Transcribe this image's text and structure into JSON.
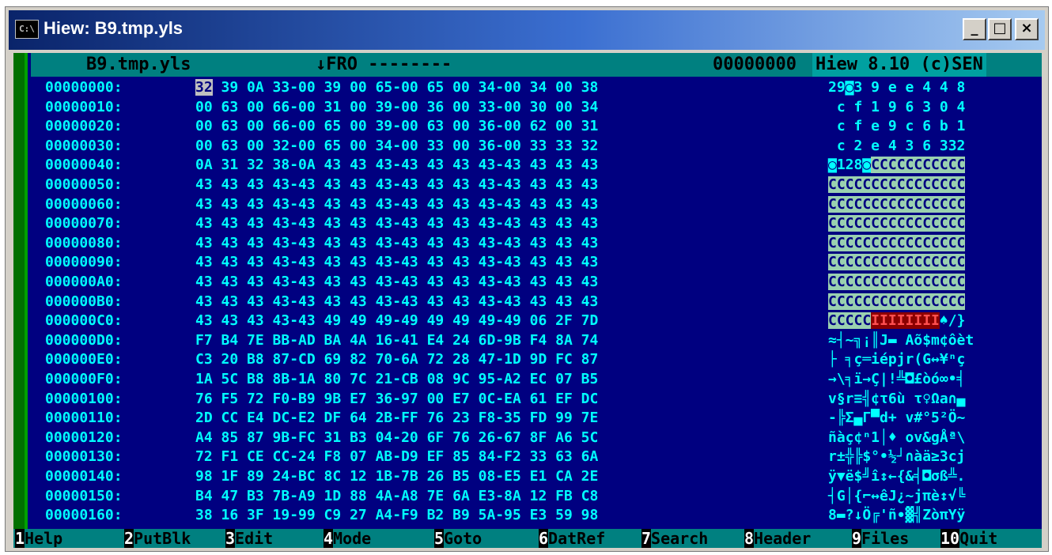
{
  "window": {
    "title": "Hiew: B9.tmp.yls",
    "icon": "C:\\"
  },
  "title_buttons": {
    "minimize": "_",
    "maximize": "□",
    "close": "×"
  },
  "status": {
    "filename": "B9.tmp.yls",
    "mode": "↓FRO --------",
    "offset": "00000000",
    "version": "Hiew 8.10 (c)SEN"
  },
  "rows": [
    {
      "addr": "00000000:",
      "hex": "32 39 0A 33-00 39 00 65-00 65 00 34-00 34 00 38",
      "ascii": "29◙3 9 e e 4 4 8"
    },
    {
      "addr": "00000010:",
      "hex": "00 63 00 66-00 31 00 39-00 36 00 33-00 30 00 34",
      "ascii": " c f 1 9 6 3 0 4"
    },
    {
      "addr": "00000020:",
      "hex": "00 63 00 66-00 65 00 39-00 63 00 36-00 62 00 31",
      "ascii": " c f e 9 c 6 b 1"
    },
    {
      "addr": "00000030:",
      "hex": "00 63 00 32-00 65 00 34-00 33 00 36-00 33 33 32",
      "ascii": " c 2 e 4 3 6 332"
    },
    {
      "addr": "00000040:",
      "hex": "0A 31 32 38-0A 43 43 43-43 43 43 43-43 43 43 43",
      "ascii": "◙128◙CCCCCCCCCCC"
    },
    {
      "addr": "00000050:",
      "hex": "43 43 43 43-43 43 43 43-43 43 43 43-43 43 43 43",
      "ascii": "CCCCCCCCCCCCCCCC"
    },
    {
      "addr": "00000060:",
      "hex": "43 43 43 43-43 43 43 43-43 43 43 43-43 43 43 43",
      "ascii": "CCCCCCCCCCCCCCCC"
    },
    {
      "addr": "00000070:",
      "hex": "43 43 43 43-43 43 43 43-43 43 43 43-43 43 43 43",
      "ascii": "CCCCCCCCCCCCCCCC"
    },
    {
      "addr": "00000080:",
      "hex": "43 43 43 43-43 43 43 43-43 43 43 43-43 43 43 43",
      "ascii": "CCCCCCCCCCCCCCCC"
    },
    {
      "addr": "00000090:",
      "hex": "43 43 43 43-43 43 43 43-43 43 43 43-43 43 43 43",
      "ascii": "CCCCCCCCCCCCCCCC"
    },
    {
      "addr": "000000A0:",
      "hex": "43 43 43 43-43 43 43 43-43 43 43 43-43 43 43 43",
      "ascii": "CCCCCCCCCCCCCCCC"
    },
    {
      "addr": "000000B0:",
      "hex": "43 43 43 43-43 43 43 43-43 43 43 43-43 43 43 43",
      "ascii": "CCCCCCCCCCCCCCCC"
    },
    {
      "addr": "000000C0:",
      "hex": "43 43 43 43-43 49 49 49-49 49 49 49-49 06 2F 7D",
      "ascii": "CCCCCIIIIIIII♠/}"
    },
    {
      "addr": "000000D0:",
      "hex": "F7 B4 7E BB-AD BA 4A 16-41 E4 24 6D-9B F4 8A 74",
      "ascii": "≈┤~╗¡║J▬ Aõ$m¢ôèt"
    },
    {
      "addr": "000000E0:",
      "hex": "C3 20 B8 87-CD 69 82 70-6A 72 28 47-1D 9D FC 87",
      "ascii": "├ ╕ç═iépjr(G↔¥ⁿç"
    },
    {
      "addr": "000000F0:",
      "hex": "1A 5C B8 8B-1A 80 7C 21-CB 08 9C 95-A2 EC 07 B5",
      "ascii": "→\\╕ï→Ç|!╩◘£òó∞•╡"
    },
    {
      "addr": "00000100:",
      "hex": "76 F5 72 F0-B9 9B E7 36-97 00 E7 0C-EA 61 EF DC",
      "ascii": "v§r≡╣¢τ6ù τ♀Ωa∩▄"
    },
    {
      "addr": "00000110:",
      "hex": "2D CC E4 DC-E2 DF 64 2B-FF 76 23 F8-35 FD 99 7E",
      "ascii": "-╠Σ▄Γ▀d+ v#°5²Ö~"
    },
    {
      "addr": "00000120:",
      "hex": "A4 85 87 9B-FC 31 B3 04-20 6F 76 26-67 8F A6 5C",
      "ascii": "ñàç¢ⁿ1│♦ ov&gÅª\\"
    },
    {
      "addr": "00000130:",
      "hex": "72 F1 CE CC-24 F8 07 AB-D9 EF 85 84-F2 33 63 6A",
      "ascii": "r±╬╠$°•½┘∩àä≥3cj"
    },
    {
      "addr": "00000140:",
      "hex": "98 1F 89 24-BC 8C 12 1B-7B 26 B5 08-E5 E1 CA 2E",
      "ascii": "ÿ▼ë$╝î↕←{&╡◘σß╩."
    },
    {
      "addr": "00000150:",
      "hex": "B4 47 B3 7B-A9 1D 88 4A-A8 7E 6A E3-8A 12 FB C8",
      "ascii": "┤G│{⌐↔êJ¿~jπè↕√╚"
    },
    {
      "addr": "00000160:",
      "hex": "38 16 3F 19-99 C9 27 A4-F9 B2 B9 5A-95 E3 59 98",
      "ascii": "8▬?↓Ö╔'ñ∙▓╣ZòπYÿ"
    }
  ],
  "fkeys": [
    {
      "num": "1",
      "label": "Help"
    },
    {
      "num": "2",
      "label": "PutBlk"
    },
    {
      "num": "3",
      "label": "Edit"
    },
    {
      "num": "4",
      "label": "Mode"
    },
    {
      "num": "5",
      "label": "Goto"
    },
    {
      "num": "6",
      "label": "DatRef"
    },
    {
      "num": "7",
      "label": "Search"
    },
    {
      "num": "8",
      "label": "Header"
    },
    {
      "num": "9",
      "label": "Files"
    },
    {
      "num": "10",
      "label": "Quit"
    }
  ]
}
